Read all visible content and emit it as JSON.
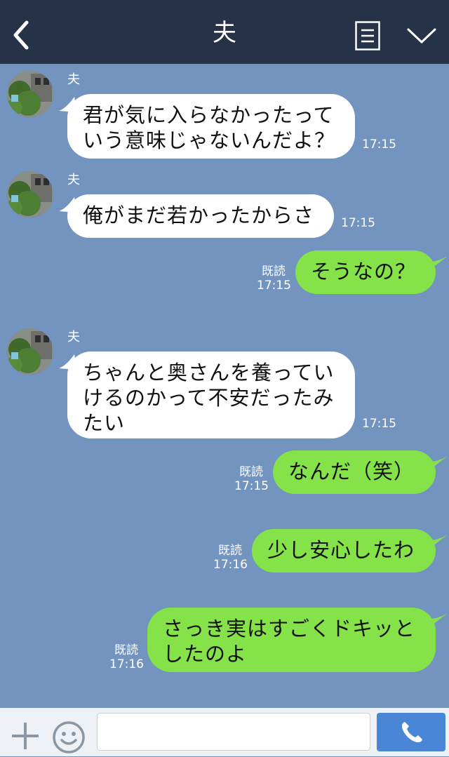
{
  "header": {
    "title": "夫"
  },
  "messages": [
    {
      "sender": "夫",
      "text_lines": [
        "君が気に入らなかったって",
        "いう意味じゃないんだよ？"
      ],
      "time": "17:15"
    },
    {
      "sender": "夫",
      "text_lines": [
        "俺がまだ若かったからさ"
      ],
      "time": "17:15"
    },
    {
      "text_lines": [
        "そうなの？"
      ],
      "read": "既読",
      "time": "17:15"
    },
    {
      "sender": "夫",
      "text_lines": [
        "ちゃんと奥さんを養ってい",
        "けるのかって不安だったみ",
        "たい"
      ],
      "time": "17:15"
    },
    {
      "text_lines": [
        "なんだ（笑）"
      ],
      "read": "既読",
      "time": "17:15"
    },
    {
      "text_lines": [
        "少し安心したわ"
      ],
      "read": "既読",
      "time": "17:16"
    },
    {
      "text_lines": [
        "さっき実はすごくドキッと",
        "したのよ"
      ],
      "read": "既読",
      "time": "17:16"
    }
  ],
  "colors": {
    "header_bg": "#263248",
    "chat_bg": "#7494c0",
    "incoming_bubble": "#ffffff",
    "outgoing_bubble": "#85e249",
    "call_button": "#4a86d6"
  },
  "icons": {
    "back": "back-chevron-icon",
    "menu": "list-menu-icon",
    "collapse": "chevron-down-icon",
    "plus": "plus-icon",
    "emoji": "emoji-icon",
    "call": "phone-icon"
  }
}
